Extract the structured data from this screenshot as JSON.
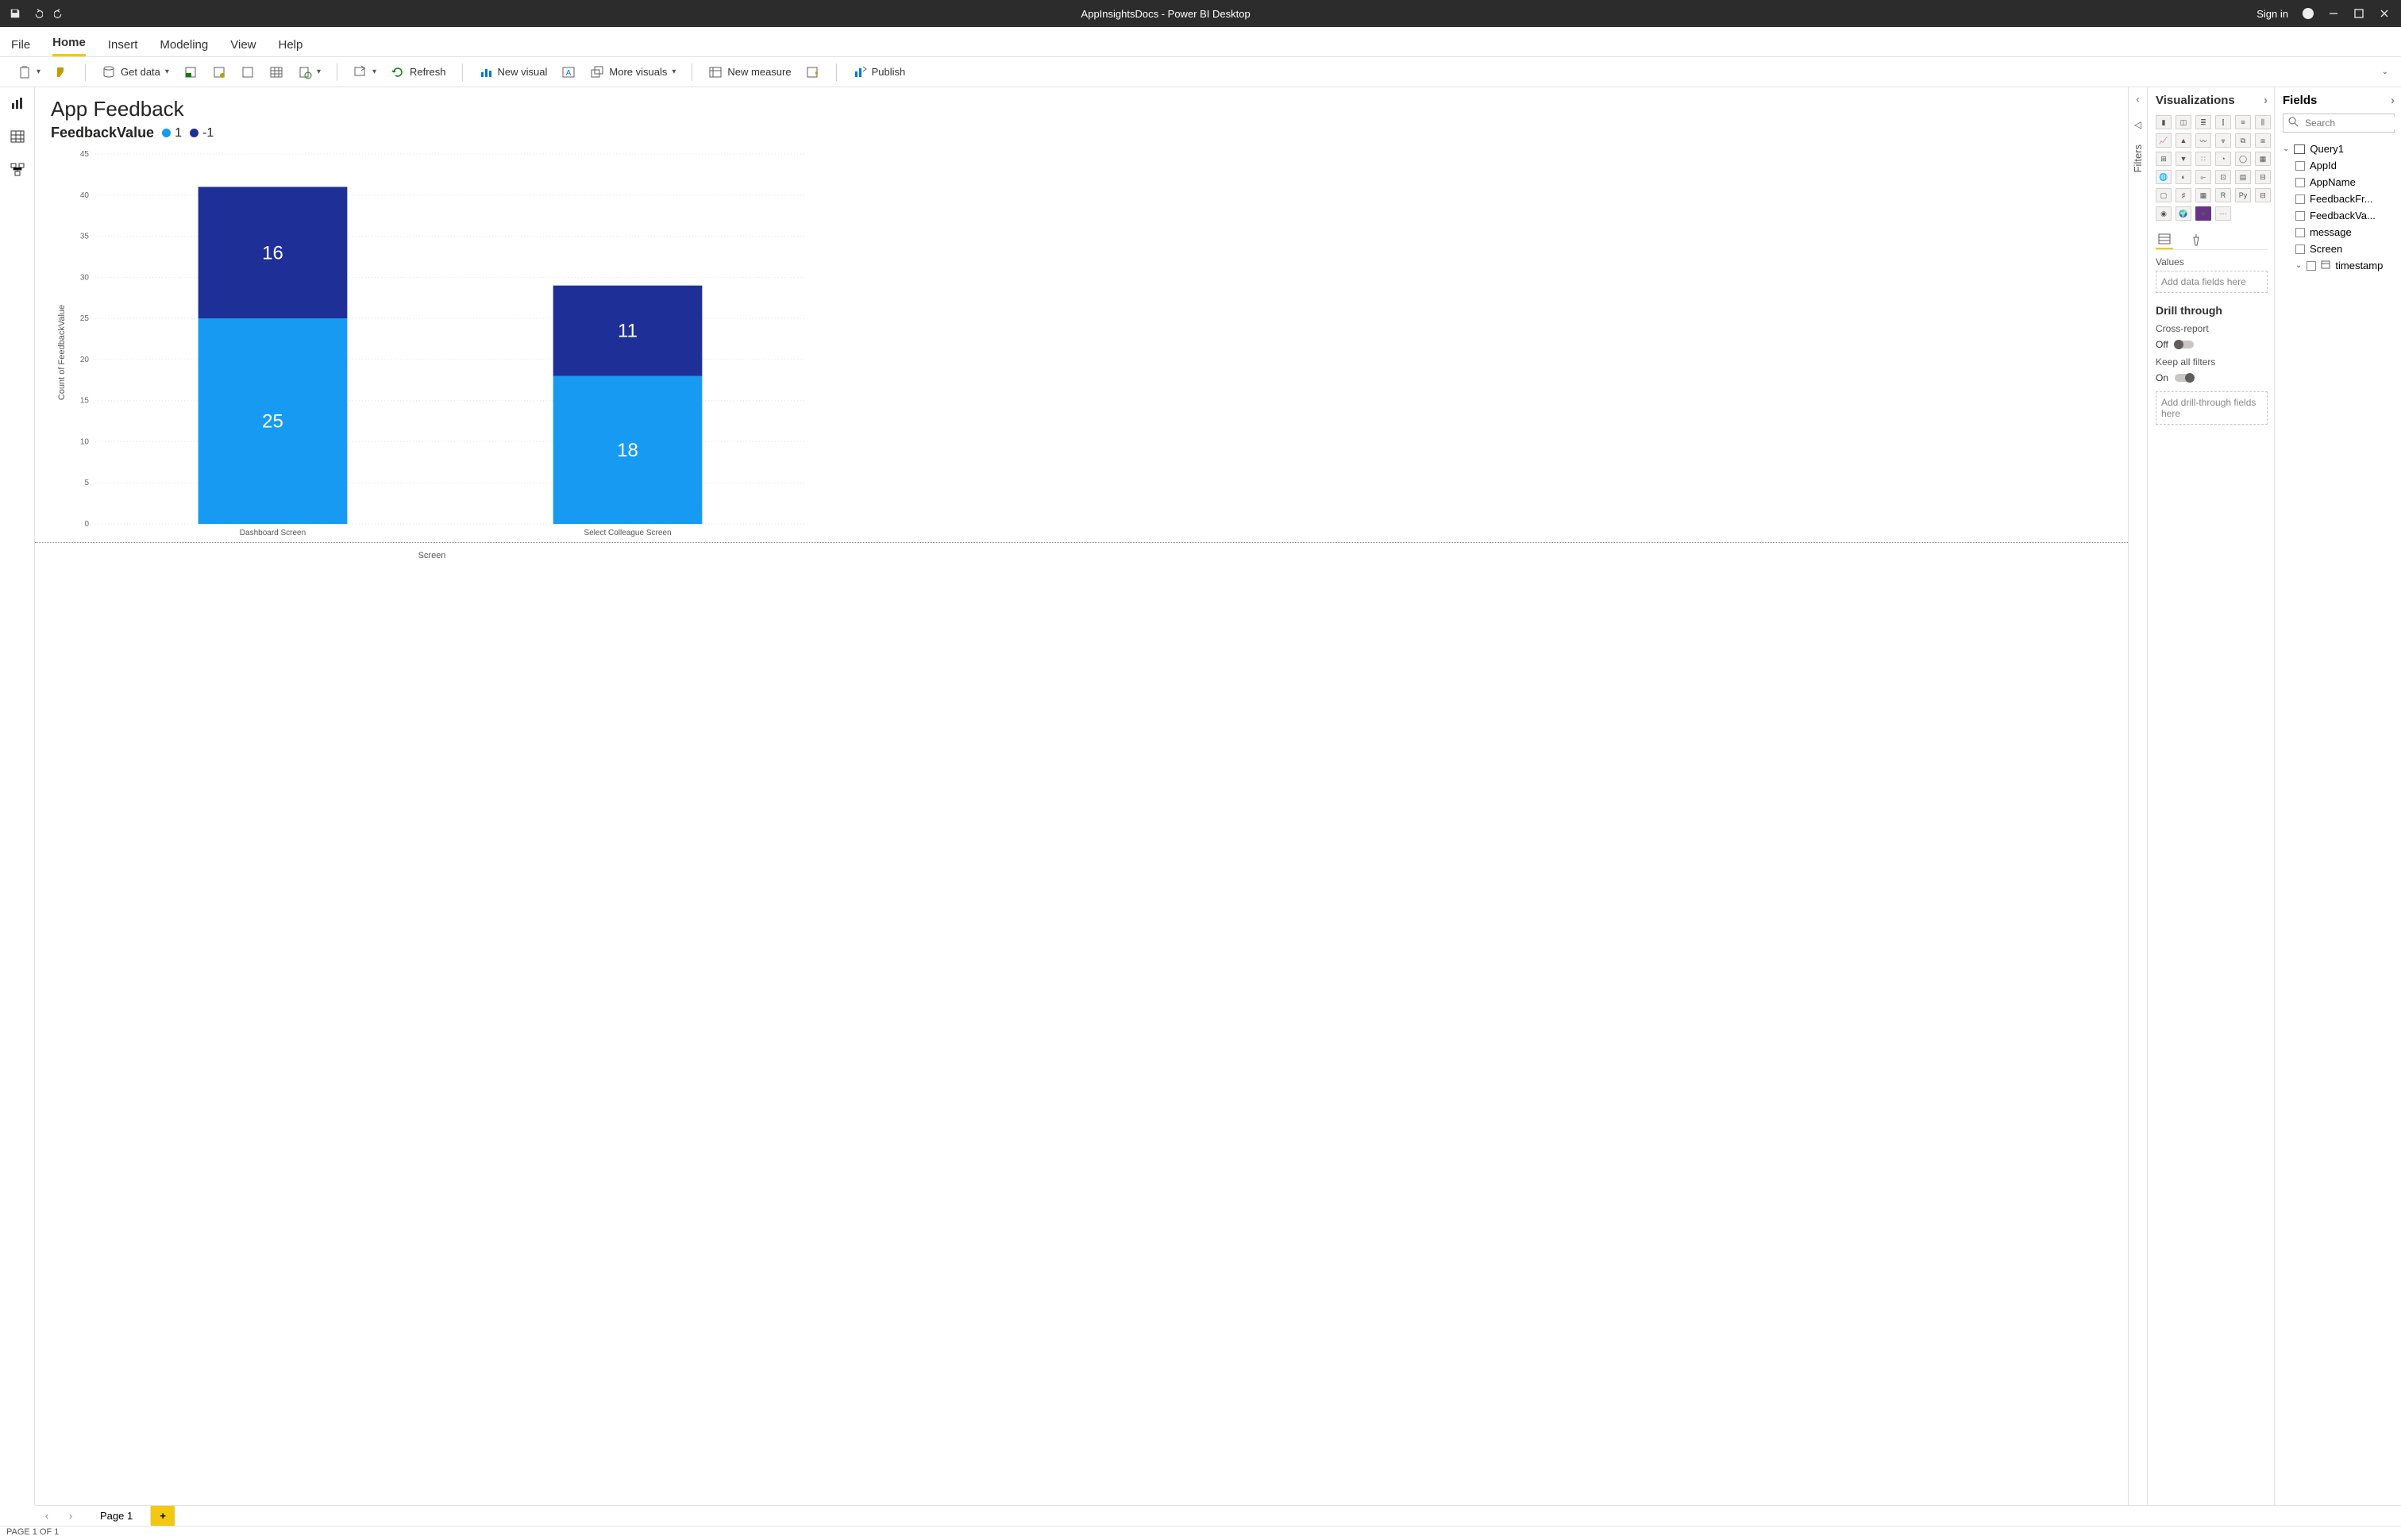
{
  "app": {
    "title": "AppInsightsDocs - Power BI Desktop",
    "sign_in": "Sign in"
  },
  "menus": {
    "file": "File",
    "home": "Home",
    "insert": "Insert",
    "modeling": "Modeling",
    "view": "View",
    "help": "Help"
  },
  "ribbon": {
    "get_data": "Get data",
    "refresh": "Refresh",
    "new_visual": "New visual",
    "more_visuals": "More visuals",
    "new_measure": "New measure",
    "publish": "Publish"
  },
  "report": {
    "title": "App Feedback",
    "legend_title": "FeedbackValue",
    "series_a_label": "1",
    "series_b_label": "-1"
  },
  "filters_pane": {
    "label": "Filters"
  },
  "viz_pane": {
    "title": "Visualizations",
    "values_label": "Values",
    "values_placeholder": "Add data fields here",
    "drill_title": "Drill through",
    "cross_report": "Cross-report",
    "cross_report_state": "Off",
    "keep_filters": "Keep all filters",
    "keep_filters_state": "On",
    "drill_placeholder": "Add drill-through fields here"
  },
  "fields_pane": {
    "title": "Fields",
    "search_placeholder": "Search",
    "table": "Query1",
    "cols": {
      "c1": "AppId",
      "c2": "AppName",
      "c3": "FeedbackFr...",
      "c4": "FeedbackVa...",
      "c5": "message",
      "c6": "Screen",
      "c7": "timestamp"
    }
  },
  "pages": {
    "p1": "Page 1"
  },
  "status": {
    "text": "PAGE 1 OF 1"
  },
  "colors": {
    "series_a": "#179af2",
    "series_b": "#1e2f97",
    "accent_yellow": "#f2c811"
  },
  "chart_data": {
    "type": "bar",
    "stacked": true,
    "title": "App Feedback",
    "xlabel": "Screen",
    "ylabel": "Count of FeedbackValue",
    "ylim": [
      0,
      45
    ],
    "yticks": [
      0,
      5,
      10,
      15,
      20,
      25,
      30,
      35,
      40,
      45
    ],
    "categories": [
      "Dashboard Screen",
      "Select Colleague Screen"
    ],
    "series": [
      {
        "name": "1",
        "color": "#179af2",
        "values": [
          25,
          18
        ]
      },
      {
        "name": "-1",
        "color": "#1e2f97",
        "values": [
          16,
          11
        ]
      }
    ]
  }
}
